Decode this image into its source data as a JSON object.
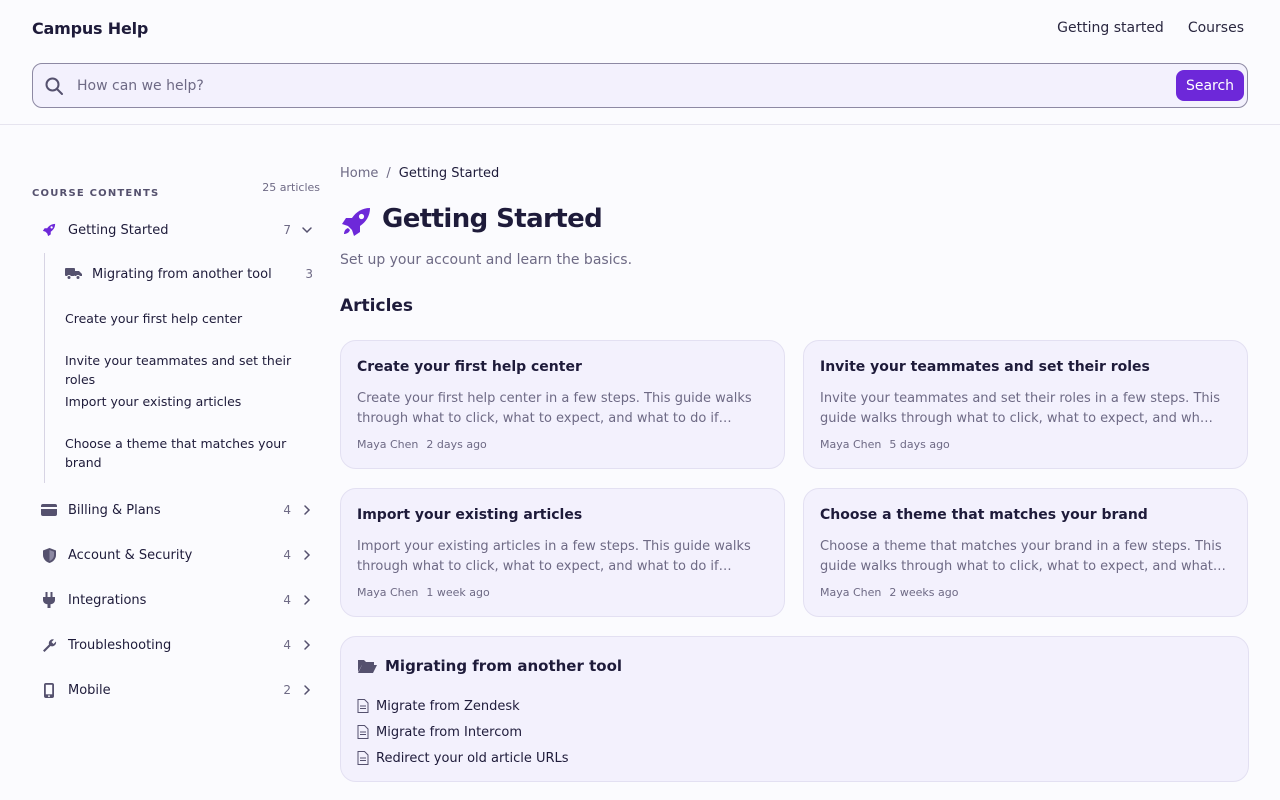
{
  "header": {
    "brand": "Campus Help",
    "nav": [
      "Getting started",
      "Courses"
    ]
  },
  "search": {
    "placeholder": "How can we help?",
    "button_label": "Search"
  },
  "sidebar": {
    "title": "COURSE CONTENTS",
    "count": "25 articles",
    "sections": [
      {
        "label": "Getting Started",
        "count": "7",
        "icon": "rocket-icon",
        "expanded": true
      },
      {
        "label": "Billing & Plans",
        "count": "4",
        "icon": "credit-card-icon"
      },
      {
        "label": "Account & Security",
        "count": "4",
        "icon": "shield-icon"
      },
      {
        "label": "Integrations",
        "count": "4",
        "icon": "plug-icon"
      },
      {
        "label": "Troubleshooting",
        "count": "4",
        "icon": "wrench-icon"
      },
      {
        "label": "Mobile",
        "count": "2",
        "icon": "phone-icon"
      }
    ],
    "subfolder": {
      "label": "Migrating from another tool",
      "count": "3",
      "icon": "truck-icon"
    },
    "sub_items": [
      "Create your first help center",
      "Invite your teammates and set their roles",
      "Import your existing articles",
      "Choose a theme that matches your brand"
    ]
  },
  "breadcrumb": {
    "home": "Home",
    "sep": "/",
    "current": "Getting Started"
  },
  "page": {
    "title": "Getting Started",
    "subtitle": "Set up your account and learn the basics.",
    "articles_heading": "Articles"
  },
  "articles": [
    {
      "title": "Create your first help center",
      "desc": "Create your first help center in a few steps. This guide walks through what to click, what to expect, and what to do if…",
      "author": "Maya Chen",
      "time": "2 days ago"
    },
    {
      "title": "Invite your teammates and set their roles",
      "desc": "Invite your teammates and set their roles in a few steps. This guide walks through what to click, what to expect, and wh…",
      "author": "Maya Chen",
      "time": "5 days ago"
    },
    {
      "title": "Import your existing articles",
      "desc": "Import your existing articles in a few steps. This guide walks through what to click, what to expect, and what to do if…",
      "author": "Maya Chen",
      "time": "1 week ago"
    },
    {
      "title": "Choose a theme that matches your brand",
      "desc": "Choose a theme that matches your brand in a few steps. This guide walks through what to click, what to expect, and what…",
      "author": "Maya Chen",
      "time": "2 weeks ago"
    }
  ],
  "folder": {
    "title": "Migrating from another tool",
    "items": [
      "Migrate from Zendesk",
      "Migrate from Intercom",
      "Redirect your old article URLs"
    ]
  },
  "colors": {
    "accent": "#6d28d9",
    "card_bg": "#f3f1fd",
    "muted": "#6e6a85"
  }
}
